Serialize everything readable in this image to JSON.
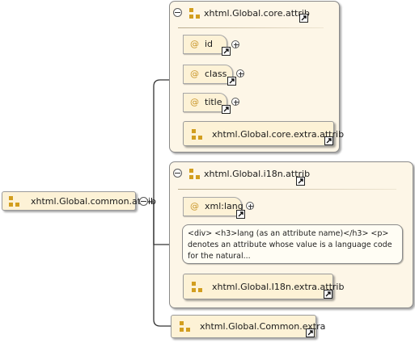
{
  "root": {
    "label": "xhtml.Global.common.attrib"
  },
  "groups": {
    "core": {
      "title": "xhtml.Global.core.attrib",
      "attributes": [
        {
          "symbol": "@",
          "name": "id"
        },
        {
          "symbol": "@",
          "name": "class"
        },
        {
          "symbol": "@",
          "name": "title"
        }
      ],
      "extra": {
        "label": "xhtml.Global.core.extra.attrib"
      }
    },
    "i18n": {
      "title": "xhtml.Global.i18n.attrib",
      "attributes": [
        {
          "symbol": "@",
          "name": "xml:lang"
        }
      ],
      "note": "<div> <h3>lang (as an attribute name)</h3> <p> denotes an attribute whose value is a language code for the natural...",
      "extra": {
        "label": "xhtml.Global.I18n.extra.attrib"
      }
    }
  },
  "common_extra": {
    "label": "xhtml.Global.Common.extra"
  },
  "colors": {
    "panel_bg": "#fdf6e7",
    "node_bg": "#fdf2d6",
    "icon": "#d29e1f",
    "attr_symbol": "#c9962a"
  }
}
